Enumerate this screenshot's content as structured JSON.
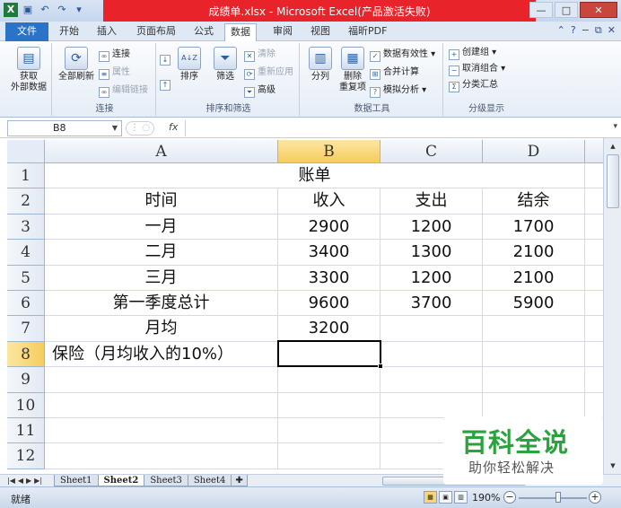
{
  "window": {
    "title": "成绩单.xlsx - Microsoft Excel(产品激活失败)",
    "qat": [
      "excel-icon",
      "save-icon",
      "undo-icon",
      "redo-icon",
      "customize-icon"
    ],
    "controls": {
      "minimize": "—",
      "maximize": "□",
      "close": "✕"
    }
  },
  "tabs": [
    "文件",
    "开始",
    "插入",
    "页面布局",
    "公式",
    "数据",
    "审阅",
    "视图",
    "福昕PDF"
  ],
  "active_tab": "数据",
  "ribbon": {
    "get_external": {
      "label": "获取\n外部数据",
      "line1": "获取",
      "line2": "外部数据"
    },
    "refresh_all": "全部刷新",
    "connections": "连接",
    "properties": "属性",
    "edit_links": "编辑链接",
    "group_connections": "连接",
    "sort_az": "A↓Z",
    "sort": "排序",
    "filter": "筛选",
    "clear": "清除",
    "reapply": "重新应用",
    "advanced": "高级",
    "group_sort_filter": "排序和筛选",
    "text_to_columns": "分列",
    "remove_duplicates": "删除\n重复项",
    "remove_line1": "删除",
    "remove_line2": "重复项",
    "data_validation": "数据有效性",
    "consolidate": "合并计算",
    "what_if": "模拟分析",
    "group_data_tools": "数据工具",
    "group": "创建组",
    "ungroup": "取消组合",
    "subtotal": "分类汇总",
    "group_outline": "分级显示"
  },
  "formula_bar": {
    "name_box": "B8",
    "fx": "fx",
    "value": ""
  },
  "columns": [
    "A",
    "B",
    "C",
    "D"
  ],
  "selected_column": "B",
  "rows": [
    {
      "n": "1",
      "A": "账单",
      "B": "",
      "C": "",
      "D": "",
      "merged": true
    },
    {
      "n": "2",
      "A": "时间",
      "B": "收入",
      "C": "支出",
      "D": "结余"
    },
    {
      "n": "3",
      "A": "一月",
      "B": "2900",
      "C": "1200",
      "D": "1700"
    },
    {
      "n": "4",
      "A": "二月",
      "B": "3400",
      "C": "1300",
      "D": "2100"
    },
    {
      "n": "5",
      "A": "三月",
      "B": "3300",
      "C": "1200",
      "D": "2100"
    },
    {
      "n": "6",
      "A": "第一季度总计",
      "B": "9600",
      "C": "3700",
      "D": "5900"
    },
    {
      "n": "7",
      "A": "月均",
      "B": "3200",
      "C": "",
      "D": ""
    },
    {
      "n": "8",
      "A": "保险（月均收入的10%）",
      "B": "",
      "C": "",
      "D": ""
    },
    {
      "n": "9",
      "A": "",
      "B": "",
      "C": "",
      "D": ""
    },
    {
      "n": "10",
      "A": "",
      "B": "",
      "C": "",
      "D": ""
    },
    {
      "n": "11",
      "A": "",
      "B": "",
      "C": "",
      "D": ""
    },
    {
      "n": "12",
      "A": "",
      "B": "",
      "C": "",
      "D": ""
    }
  ],
  "selected_row": "8",
  "sheets": [
    "Sheet1",
    "Sheet2",
    "Sheet3",
    "Sheet4"
  ],
  "active_sheet": "Sheet2",
  "status": {
    "ready": "就绪",
    "zoom": "190%",
    "zoom_fraction": 0.58
  },
  "watermark": {
    "logo": "百科全说",
    "tagline": "助你轻松解决"
  }
}
